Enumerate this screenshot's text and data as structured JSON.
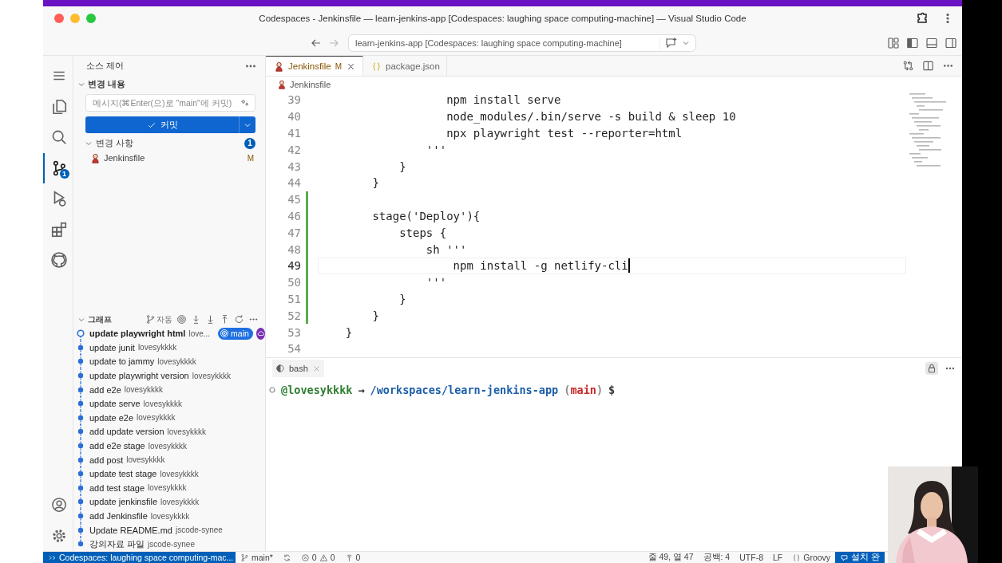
{
  "window": {
    "title": "Codespaces - Jenkinsfile — learn-jenkins-app [Codespaces: laughing space computing-machine] — Visual Studio Code"
  },
  "command_center": {
    "text": "learn-jenkins-app [Codespaces: laughing space computing-machine]"
  },
  "activity_bar": {
    "items": [
      {
        "kind": "explorer",
        "selected": false
      },
      {
        "kind": "search",
        "selected": false
      },
      {
        "kind": "source-control",
        "selected": true,
        "badge": "1"
      },
      {
        "kind": "run",
        "selected": false
      },
      {
        "kind": "extensions",
        "selected": false
      },
      {
        "kind": "github",
        "selected": false
      }
    ]
  },
  "sidebar": {
    "title": "소스 제어",
    "changes_section": {
      "title": "변경 내용",
      "expanded": true
    },
    "message_field": {
      "placeholder": "메시지(⌘Enter(으)로 \"main\"에 커밋)"
    },
    "commit_button": {
      "label": "커밋"
    },
    "changes": {
      "title": "변경 사항",
      "count": "1",
      "expanded": true,
      "files": [
        {
          "name": "Jenkinsfile",
          "status": "M"
        }
      ]
    },
    "graph": {
      "title": "그래프",
      "expanded": true,
      "auto_label": "자동",
      "commits": [
        {
          "message": "update playwright html",
          "author": "love...",
          "current": true,
          "branch": "main"
        },
        {
          "message": "update junit",
          "author": "lovesykkkk",
          "current": false
        },
        {
          "message": "update to jammy",
          "author": "lovesykkkk",
          "current": false
        },
        {
          "message": "update playwright version",
          "author": "lovesykkkk",
          "current": false
        },
        {
          "message": "add e2e",
          "author": "lovesykkkk",
          "current": false
        },
        {
          "message": "update serve",
          "author": "lovesykkkk",
          "current": false
        },
        {
          "message": "update e2e",
          "author": "lovesykkkk",
          "current": false
        },
        {
          "message": "add update version",
          "author": "lovesykkkk",
          "current": false
        },
        {
          "message": "add e2e stage",
          "author": "lovesykkkk",
          "current": false
        },
        {
          "message": "add post",
          "author": "lovesykkkk",
          "current": false
        },
        {
          "message": "update test stage",
          "author": "lovesykkkk",
          "current": false
        },
        {
          "message": "add test stage",
          "author": "lovesykkkk",
          "current": false
        },
        {
          "message": "update jenkinsfile",
          "author": "lovesykkkk",
          "current": false
        },
        {
          "message": "add Jenkinsfile",
          "author": "lovesykkkk",
          "current": false
        },
        {
          "message": "Update README.md",
          "author": "jscode-synee",
          "current": false
        },
        {
          "message": "강의자료 파일",
          "author": "jscode-synee",
          "current": false
        }
      ]
    }
  },
  "editor": {
    "tabs": [
      {
        "label": "Jenkinsfile",
        "kind": "jenkins",
        "status": "M",
        "selected": true
      },
      {
        "label": "package.json",
        "kind": "json",
        "selected": false
      }
    ],
    "breadcrumb": "Jenkinsfile",
    "lines": [
      {
        "number": "39",
        "text": "                   npm install serve",
        "modified": false,
        "current": false
      },
      {
        "number": "40",
        "text": "                   node_modules/.bin/serve -s build & sleep 10",
        "modified": false,
        "current": false
      },
      {
        "number": "41",
        "text": "                   npx playwright test --reporter=html",
        "modified": false,
        "current": false
      },
      {
        "number": "42",
        "text": "                '''",
        "modified": false,
        "current": false
      },
      {
        "number": "43",
        "text": "            }",
        "modified": false,
        "current": false
      },
      {
        "number": "44",
        "text": "        }",
        "modified": false,
        "current": false
      },
      {
        "number": "45",
        "modified": true,
        "current": false
      },
      {
        "number": "46",
        "text": "        stage('Deploy'){",
        "modified": true,
        "current": false
      },
      {
        "number": "47",
        "text": "            steps {",
        "modified": true,
        "current": false
      },
      {
        "number": "48",
        "text": "                sh '''",
        "modified": true,
        "current": false
      },
      {
        "number": "49",
        "text": "                    npm install -g netlify-cli",
        "modified": true,
        "current": true
      },
      {
        "number": "50",
        "text": "                '''",
        "modified": true,
        "current": false
      },
      {
        "number": "51",
        "text": "            }",
        "modified": true,
        "current": false
      },
      {
        "number": "52",
        "text": "        }",
        "modified": true,
        "current": false
      },
      {
        "number": "53",
        "text": "    }",
        "modified": false,
        "current": false
      },
      {
        "number": "54",
        "modified": false,
        "current": false
      }
    ]
  },
  "panel": {
    "tabs": [
      {
        "label": "bash",
        "selected": true
      }
    ],
    "prompt": [
      {
        "text": "@lovesykkkk",
        "color": "#2e7d32"
      },
      {
        "text": "→",
        "color": "#333333"
      },
      {
        "text": "/workspaces/learn-jenkins-app",
        "color": "#1c5ea8"
      },
      {
        "text": "(",
        "color": "#8a8a8a"
      },
      {
        "text": "main",
        "color": "#c62828"
      },
      {
        "text": ")",
        "color": "#8a8a8a"
      },
      {
        "text": "$",
        "color": "#333333"
      }
    ]
  },
  "status_bar": {
    "remote": "Codespaces: laughing space computing-mac...",
    "branch": "main*",
    "errors": "0",
    "warnings": "0",
    "ports": "0",
    "items": [
      "줄 49, 열 47",
      "공백: 4",
      "UTF-8",
      "LF"
    ],
    "language": "Groovy",
    "notification": "설치 완"
  }
}
